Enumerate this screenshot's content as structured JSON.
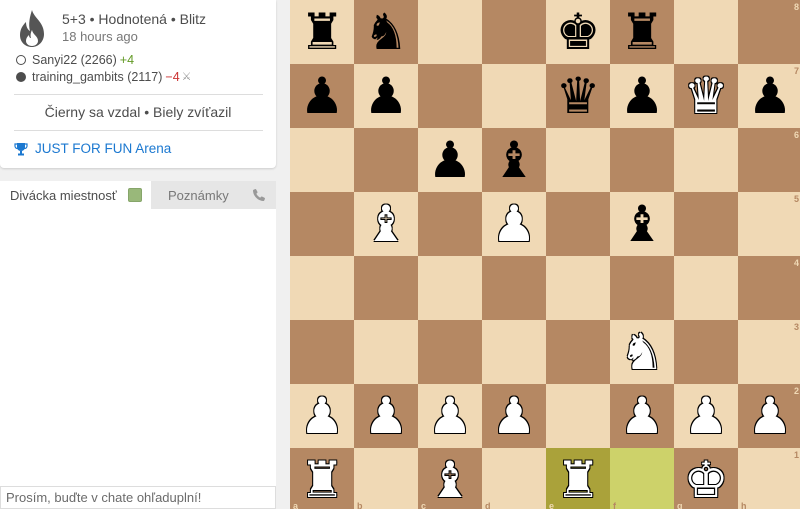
{
  "game": {
    "meta": "5+3 • Hodnotená • Blitz",
    "time_ago": "18 hours ago",
    "white_player": {
      "name": "Sanyi22 (2266)",
      "diff": "+4"
    },
    "black_player": {
      "name": "training_gambits (2117)",
      "diff": "−4",
      "icon": "berserk-icon"
    },
    "result": "Čierny sa vzdal • Biely zvíťazil",
    "tournament": "JUST FOR FUN Arena"
  },
  "chat": {
    "tab_room": "Divácka miestnosť",
    "tab_notes": "Poznámky",
    "placeholder": "Prosím, buďte v chate ohľaduplní!"
  },
  "board": {
    "orientation": "white",
    "colors": {
      "light": "#f0d9b5",
      "dark": "#b58863",
      "last_move_dark": "#aaa23a",
      "last_move_light": "#cdd26a"
    },
    "last_move": [
      "e1",
      "f1"
    ],
    "files": [
      "a",
      "b",
      "c",
      "d",
      "e",
      "f",
      "g",
      "h"
    ],
    "ranks": [
      "8",
      "7",
      "6",
      "5",
      "4",
      "3",
      "2",
      "1"
    ],
    "pieces": [
      {
        "sq": "a8",
        "p": "r"
      },
      {
        "sq": "b8",
        "p": "n"
      },
      {
        "sq": "e8",
        "p": "k"
      },
      {
        "sq": "f8",
        "p": "r"
      },
      {
        "sq": "a7",
        "p": "p"
      },
      {
        "sq": "b7",
        "p": "p"
      },
      {
        "sq": "e7",
        "p": "q"
      },
      {
        "sq": "f7",
        "p": "p"
      },
      {
        "sq": "g7",
        "p": "Q"
      },
      {
        "sq": "h7",
        "p": "p"
      },
      {
        "sq": "c6",
        "p": "p"
      },
      {
        "sq": "d6",
        "p": "b"
      },
      {
        "sq": "b5",
        "p": "B"
      },
      {
        "sq": "d5",
        "p": "P"
      },
      {
        "sq": "f5",
        "p": "b"
      },
      {
        "sq": "f3",
        "p": "N"
      },
      {
        "sq": "a2",
        "p": "P"
      },
      {
        "sq": "b2",
        "p": "P"
      },
      {
        "sq": "c2",
        "p": "P"
      },
      {
        "sq": "d2",
        "p": "P"
      },
      {
        "sq": "f2",
        "p": "P"
      },
      {
        "sq": "g2",
        "p": "P"
      },
      {
        "sq": "h2",
        "p": "P"
      },
      {
        "sq": "a1",
        "p": "R"
      },
      {
        "sq": "c1",
        "p": "B"
      },
      {
        "sq": "e1",
        "p": "R"
      },
      {
        "sq": "g1",
        "p": "K"
      }
    ]
  }
}
